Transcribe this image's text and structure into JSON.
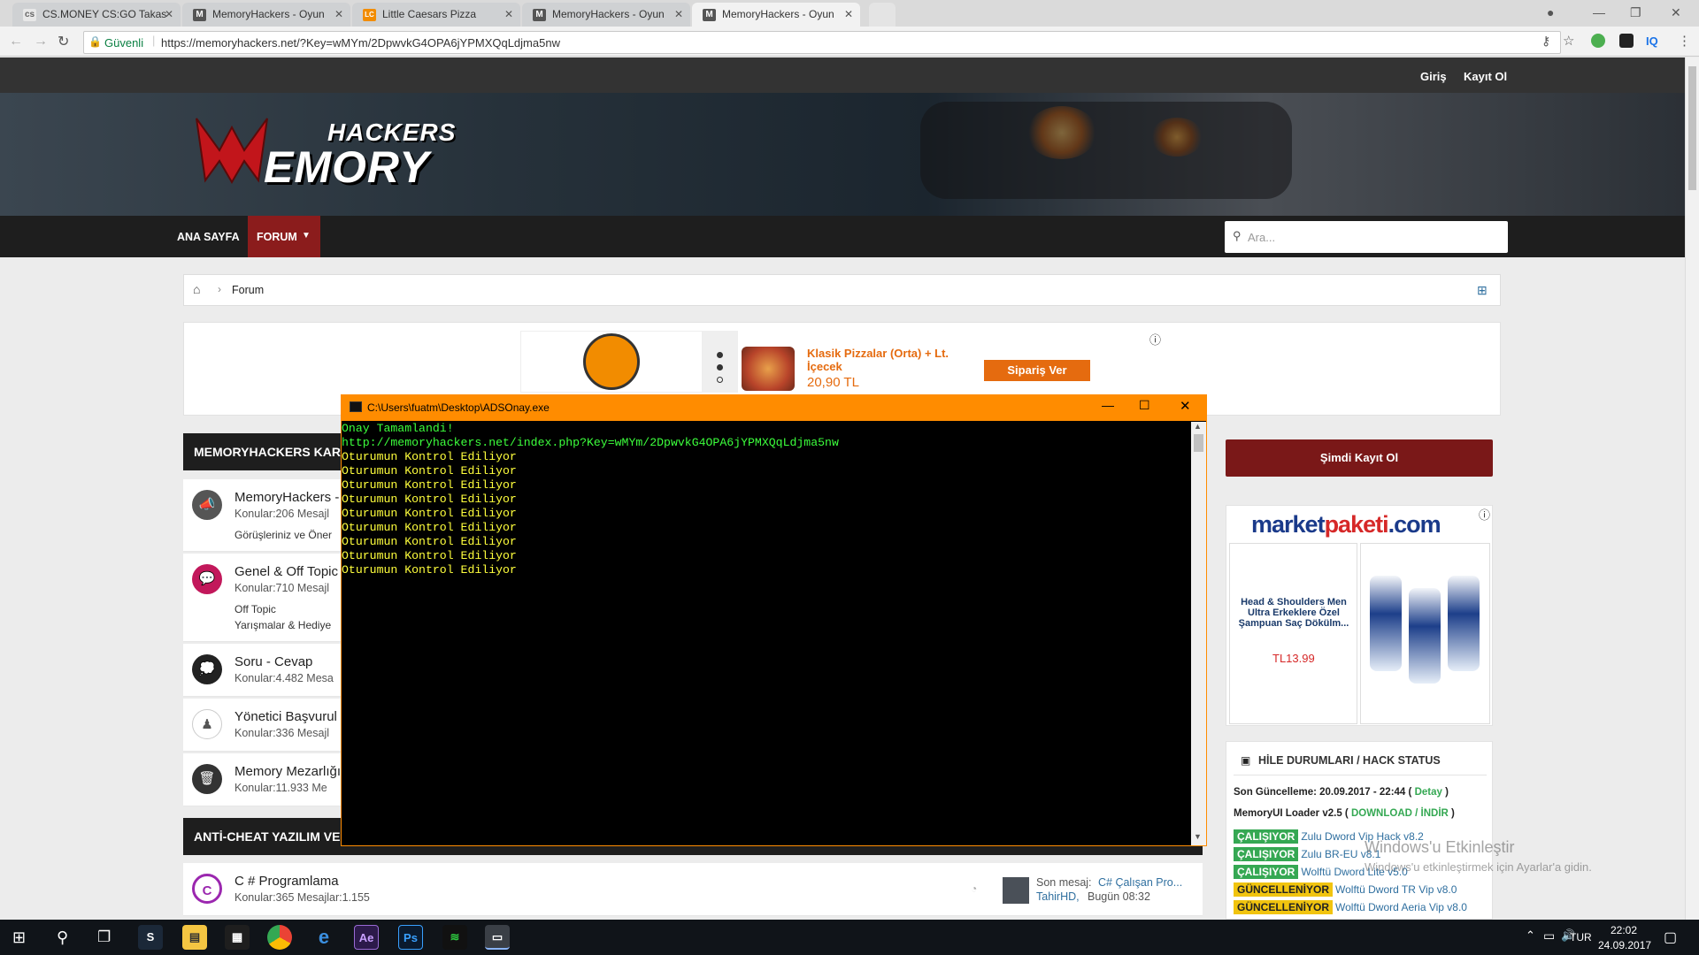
{
  "browser": {
    "tabs": [
      {
        "label": "CS.MONEY CS:GO Takas",
        "icon": "csmoney-icon",
        "fav": "cs"
      },
      {
        "label": "MemoryHackers - Oyun",
        "icon": "memoryhackers-favicon",
        "fav": "M"
      },
      {
        "label": "Little Caesars Pizza",
        "icon": "little-caesars-favicon",
        "fav": "LC"
      },
      {
        "label": "MemoryHackers - Oyun",
        "icon": "memoryhackers-favicon",
        "fav": "M"
      },
      {
        "label": "MemoryHackers - Oyun",
        "icon": "memoryhackers-favicon",
        "fav": "M",
        "active": true
      }
    ],
    "secure_label": "Güvenli",
    "url": "https://memoryhackers.net/?Key=wMYm/2DpwvkG4OPA6jYPMXQqLdjma5nw",
    "ext_label": "IQ"
  },
  "site": {
    "login": "Giriş",
    "register": "Kayıt Ol",
    "logo_top": "HACKERS",
    "logo_bottom": "EMORY",
    "nav": [
      "ANA SAYFA",
      "FORUM"
    ],
    "search_placeholder": "Ara...",
    "breadcrumb": "Forum"
  },
  "ad": {
    "product": "Klasik Pizzalar (Orta) + Lt. İçecek",
    "price": "20,90 TL",
    "cta": "Sipariş Ver"
  },
  "sections": [
    {
      "title": "MEMORYHACKERS KAR"
    },
    {
      "title": "ANTİ-CHEAT YAZILIM VE"
    }
  ],
  "forums": [
    {
      "title": "MemoryHackers -",
      "meta": "Konular:206  Mesajl",
      "sub": [
        "Görüşleriniz ve Öner"
      ],
      "icon": "megaphone-icon"
    },
    {
      "title": "Genel & Off Topic",
      "meta": "Konular:710  Mesajl",
      "sub": [
        "Off Topic",
        "Yarışmalar & Hediye"
      ],
      "icon": "chat-icon"
    },
    {
      "title": "Soru - Cevap",
      "meta": "Konular:4.482  Mesa",
      "sub": [],
      "icon": "speech-bubble-icon"
    },
    {
      "title": "Yönetici Başvurul",
      "meta": "Konular:336  Mesajl",
      "sub": [],
      "icon": "chess-pawn-icon"
    },
    {
      "title": "Memory Mezarlığı",
      "meta": "Konular:11.933  Me",
      "sub": [],
      "icon": "trash-icon"
    }
  ],
  "forum_bottom": {
    "title": "C # Programlama",
    "meta": "Konular:365  Mesajlar:1.155",
    "last_label": "Son mesaj:",
    "last_title": "C# Çalışan Pro...",
    "last_user": "TahirHD,",
    "last_time": "Bugün 08:32"
  },
  "console": {
    "title": "C:\\Users\\fuatm\\Desktop\\ADSOnay.exe",
    "lines": [
      "Onay Tamamlandi!",
      "http://memoryhackers.net/index.php?Key=wMYm/2DpwvkG4OPA6jYPMXQqLdjma5nw",
      "Oturumun Kontrol Ediliyor",
      "Oturumun Kontrol Ediliyor",
      "Oturumun Kontrol Ediliyor",
      "Oturumun Kontrol Ediliyor",
      "Oturumun Kontrol Ediliyor",
      "Oturumun Kontrol Ediliyor",
      "Oturumun Kontrol Ediliyor",
      "Oturumun Kontrol Ediliyor",
      "Oturumun Kontrol Ediliyor"
    ]
  },
  "sidebar": {
    "register_button": "Şimdi Kayıt Ol",
    "market_logo_a": "market",
    "market_logo_b": "paketi",
    "market_logo_c": ".com",
    "product_title": "Head & Shoulders Men Ultra Erkeklere Özel Şampuan Saç Dökülm...",
    "product_price": "TL13.99",
    "hack_status_title": "HİLE DURUMLARI / HACK STATUS",
    "last_update_label": "Son Güncelleme: 20.09.2017 - 22:44 (",
    "last_update_link": "Detay",
    "last_update_end": ")",
    "loader_label": "MemoryUI Loader v2.5 (",
    "loader_link": "DOWNLOAD / İNDİR",
    "loader_end": ")",
    "hacks": [
      {
        "status": "ÇALIŞIYOR",
        "name": "Zulu Dword Vip Hack v8.2",
        "kind": "run"
      },
      {
        "status": "ÇALIŞIYOR",
        "name": "Zulu BR-EU v8.1",
        "kind": "run"
      },
      {
        "status": "ÇALIŞIYOR",
        "name": "Wolftü Dword Lite v5.0",
        "kind": "run"
      },
      {
        "status": "GÜNCELLENİYOR",
        "name": "Wolftü Dword TR Vip v8.0",
        "kind": "upd"
      },
      {
        "status": "GÜNCELLENİYOR",
        "name": "Wolftü Dword Aeria Vip v8.0",
        "kind": "upd"
      }
    ]
  },
  "watermark": {
    "title": "Windows'u Etkinleştir",
    "sub": "Windows'u etkinleştirmek için Ayarlar'a gidin."
  },
  "taskbar": {
    "lang": "TUR",
    "time": "22:02",
    "date": "24.09.2017"
  },
  "colors": {
    "accent": "#8b1c1c",
    "console_orange": "#ff8c00",
    "console_green": "#3cff3c",
    "console_yellow": "#ffff3c"
  }
}
